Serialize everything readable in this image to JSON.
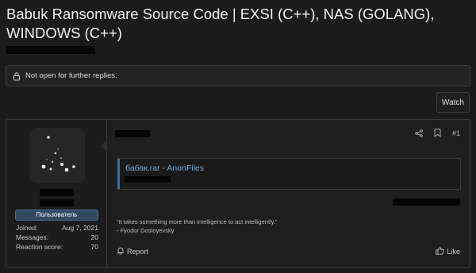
{
  "thread": {
    "title": "Babuk Ransomware Source Code | EXSI (C++), NAS (GOLANG), WINDOWS (C++)",
    "locked_notice": "Not open for further replies.",
    "watch_label": "Watch"
  },
  "post": {
    "number": "#1",
    "link_title": "бабак.rar - AnonFiles",
    "signature_quote": "“It takes something more than intelligence to act intelligently.”",
    "signature_author": "- Fyodor Dostoyevsky",
    "report_label": "Report",
    "like_label": "Like"
  },
  "user": {
    "role": "Пользователь",
    "stats": [
      {
        "label": "Joined:",
        "value": "Aug 7, 2021"
      },
      {
        "label": "Messages:",
        "value": "20"
      },
      {
        "label": "Reaction score:",
        "value": "70"
      }
    ]
  },
  "colors": {
    "background": "#1b1b1b",
    "link": "#6ea8de",
    "badge": "#314a63"
  },
  "icons": {
    "locked": "lock-icon",
    "share": "share-icon",
    "bookmark": "bookmark-icon",
    "report": "flag-icon",
    "like": "thumbs-up-icon"
  }
}
